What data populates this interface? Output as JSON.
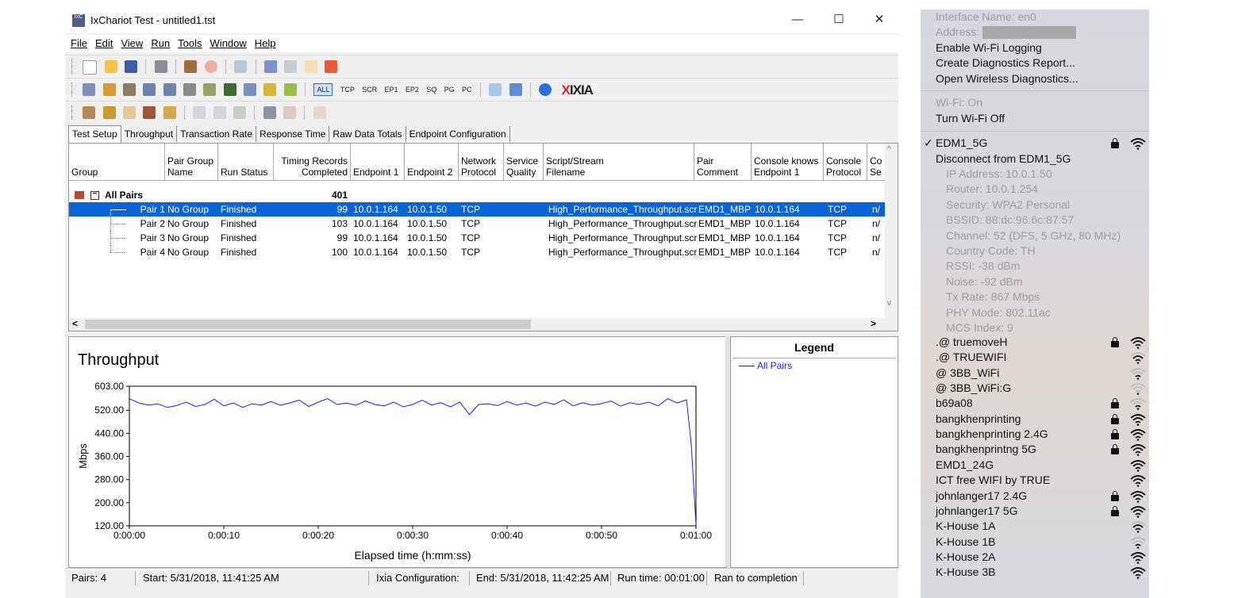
{
  "window": {
    "title": "IxChariot Test - untitled1.tst",
    "icon_text": "IxC",
    "controls": {
      "minimize": "—",
      "maximize": "☐",
      "close": "✕"
    }
  },
  "menubar": [
    "File",
    "Edit",
    "View",
    "Run",
    "Tools",
    "Window",
    "Help"
  ],
  "toolbar3_text": [
    "ALL",
    "TCP",
    "SCR",
    "EP1",
    "EP2",
    "SQ",
    "PG",
    "PC"
  ],
  "brand": {
    "logo": "IXIA",
    "logo_x": "X"
  },
  "tabs": [
    "Test Setup",
    "Throughput",
    "Transaction Rate",
    "Response Time",
    "Raw Data Totals",
    "Endpoint Configuration"
  ],
  "grid": {
    "columns": [
      "Group",
      "Pair Group\nName",
      "Run Status",
      "Timing Records\nCompleted",
      "Endpoint 1",
      "Endpoint 2",
      "Network\nProtocol",
      "Service\nQuality",
      "Script/Stream\nFilename",
      "Pair\nComment",
      "Console knows\nEndpoint 1",
      "Console\nProtocol",
      "Co\nSe"
    ],
    "summary": {
      "label": "All Pairs",
      "records": "401"
    },
    "rows": [
      [
        "Pair 1",
        "No Group",
        "Finished",
        "99",
        "10.0.1.164",
        "10.0.1.50",
        "TCP",
        "",
        "High_Performance_Throughput.scr",
        "EMD1_MBP",
        "10.0.1.164",
        "TCP",
        "n/"
      ],
      [
        "Pair 2",
        "No Group",
        "Finished",
        "103",
        "10.0.1.164",
        "10.0.1.50",
        "TCP",
        "",
        "High_Performance_Throughput.scr",
        "EMD1_MBP",
        "10.0.1.164",
        "TCP",
        "n/"
      ],
      [
        "Pair 3",
        "No Group",
        "Finished",
        "99",
        "10.0.1.164",
        "10.0.1.50",
        "TCP",
        "",
        "High_Performance_Throughput.scr",
        "EMD1_MBP",
        "10.0.1.164",
        "TCP",
        "n/"
      ],
      [
        "Pair 4",
        "No Group",
        "Finished",
        "100",
        "10.0.1.164",
        "10.0.1.50",
        "TCP",
        "",
        "High_Performance_Throughput.scr",
        "EMD1_MBP",
        "10.0.1.164",
        "TCP",
        "n/"
      ]
    ],
    "scroll": {
      "left": "<",
      "right": ">",
      "up": "^",
      "down": "v"
    }
  },
  "chart_data": {
    "type": "line",
    "title": "Throughput",
    "xlabel": "Elapsed time (h:mm:ss)",
    "ylabel": "Mbps",
    "xlim": [
      0,
      60
    ],
    "ylim": [
      120,
      603
    ],
    "x_ticks": [
      "0:00:00",
      "0:00:10",
      "0:00:20",
      "0:00:30",
      "0:00:40",
      "0:00:50",
      "0:01:00"
    ],
    "y_ticks": [
      "603.00",
      "520.00",
      "440.00",
      "360.00",
      "280.00",
      "200.00",
      "120.00"
    ],
    "y_tick_values": [
      603,
      520,
      440,
      360,
      280,
      200,
      120
    ],
    "series": [
      {
        "name": "All Pairs",
        "color": "#1a1aff",
        "x": [
          0,
          1,
          2,
          3,
          4,
          5,
          6,
          7,
          8,
          9,
          10,
          11,
          12,
          13,
          14,
          15,
          16,
          17,
          18,
          19,
          20,
          21,
          22,
          23,
          24,
          25,
          26,
          27,
          28,
          29,
          30,
          31,
          32,
          33,
          34,
          35,
          36,
          37,
          38,
          39,
          40,
          41,
          42,
          43,
          44,
          45,
          46,
          47,
          48,
          49,
          50,
          51,
          52,
          53,
          54,
          55,
          56,
          57,
          58,
          59,
          59.5,
          60
        ],
        "values": [
          560,
          545,
          538,
          542,
          530,
          536,
          548,
          533,
          540,
          558,
          535,
          545,
          530,
          542,
          538,
          550,
          537,
          545,
          555,
          533,
          548,
          560,
          540,
          545,
          537,
          552,
          540,
          535,
          548,
          532,
          540,
          555,
          538,
          546,
          532,
          548,
          505,
          540,
          542,
          536,
          550,
          538,
          545,
          534,
          548,
          540,
          556,
          535,
          546,
          538,
          543,
          552,
          534,
          546,
          540,
          548,
          535,
          560,
          545,
          556,
          400,
          125
        ]
      }
    ],
    "legend": "right",
    "grid": true
  },
  "legend": {
    "title": "Legend",
    "entry": "All Pairs"
  },
  "statusbar": {
    "pairs": "Pairs: 4",
    "start": "Start: 5/31/2018, 11:41:25 AM",
    "config": "Ixia Configuration:",
    "end": "End: 5/31/2018, 11:42:25 AM",
    "runtime": "Run time: 00:01:00",
    "result": "Ran to completion"
  },
  "wifi_menu": {
    "interface": "Interface Name: en0",
    "address": "Address:",
    "actions": [
      "Enable Wi-Fi Logging",
      "Create Diagnostics Report...",
      "Open Wireless Diagnostics..."
    ],
    "status": "Wi-Fi: On",
    "toggle": "Turn Wi-Fi Off",
    "current": {
      "checkmark": "✓",
      "ssid": "EDM1_5G",
      "disconnect": "Disconnect from EDM1_5G",
      "details": [
        "IP Address: 10.0.1.50",
        "Router: 10.0.1.254",
        "Security: WPA2 Personal",
        "BSSID: 88:dc:96:6c:87:57",
        "Channel: 52 (DFS, 5 GHz, 80 MHz)",
        "Country Code: TH",
        "RSSI: -38 dBm",
        "Noise: -92 dBm",
        "Tx Rate: 867 Mbps",
        "PHY Mode: 802.11ac",
        "MCS Index: 9"
      ]
    },
    "networks": [
      {
        "name": ".@ truemoveH",
        "locked": true,
        "bars": 4
      },
      {
        "name": ".@ TRUEWIFI",
        "locked": false,
        "bars": 3
      },
      {
        "name": "@ 3BB_WiFi",
        "locked": false,
        "bars": 2
      },
      {
        "name": "@ 3BB_WiFi:G",
        "locked": false,
        "bars": 1
      },
      {
        "name": "b69a08",
        "locked": true,
        "bars": 2
      },
      {
        "name": "bangkhenprinting",
        "locked": true,
        "bars": 4
      },
      {
        "name": "bangkhenprinting 2.4G",
        "locked": true,
        "bars": 4
      },
      {
        "name": "bangkhenprintng 5G",
        "locked": true,
        "bars": 4
      },
      {
        "name": "EMD1_24G",
        "locked": false,
        "bars": 4
      },
      {
        "name": "ICT free WIFI by TRUE",
        "locked": false,
        "bars": 4
      },
      {
        "name": "johnlanger17 2.4G",
        "locked": true,
        "bars": 4
      },
      {
        "name": "johnlanger17 5G",
        "locked": true,
        "bars": 4
      },
      {
        "name": "K-House 1A",
        "locked": false,
        "bars": 3
      },
      {
        "name": "K-House 1B",
        "locked": false,
        "bars": 2
      },
      {
        "name": "K-House 2A",
        "locked": false,
        "bars": 4
      },
      {
        "name": "K-House 3B",
        "locked": false,
        "bars": 4
      }
    ]
  }
}
